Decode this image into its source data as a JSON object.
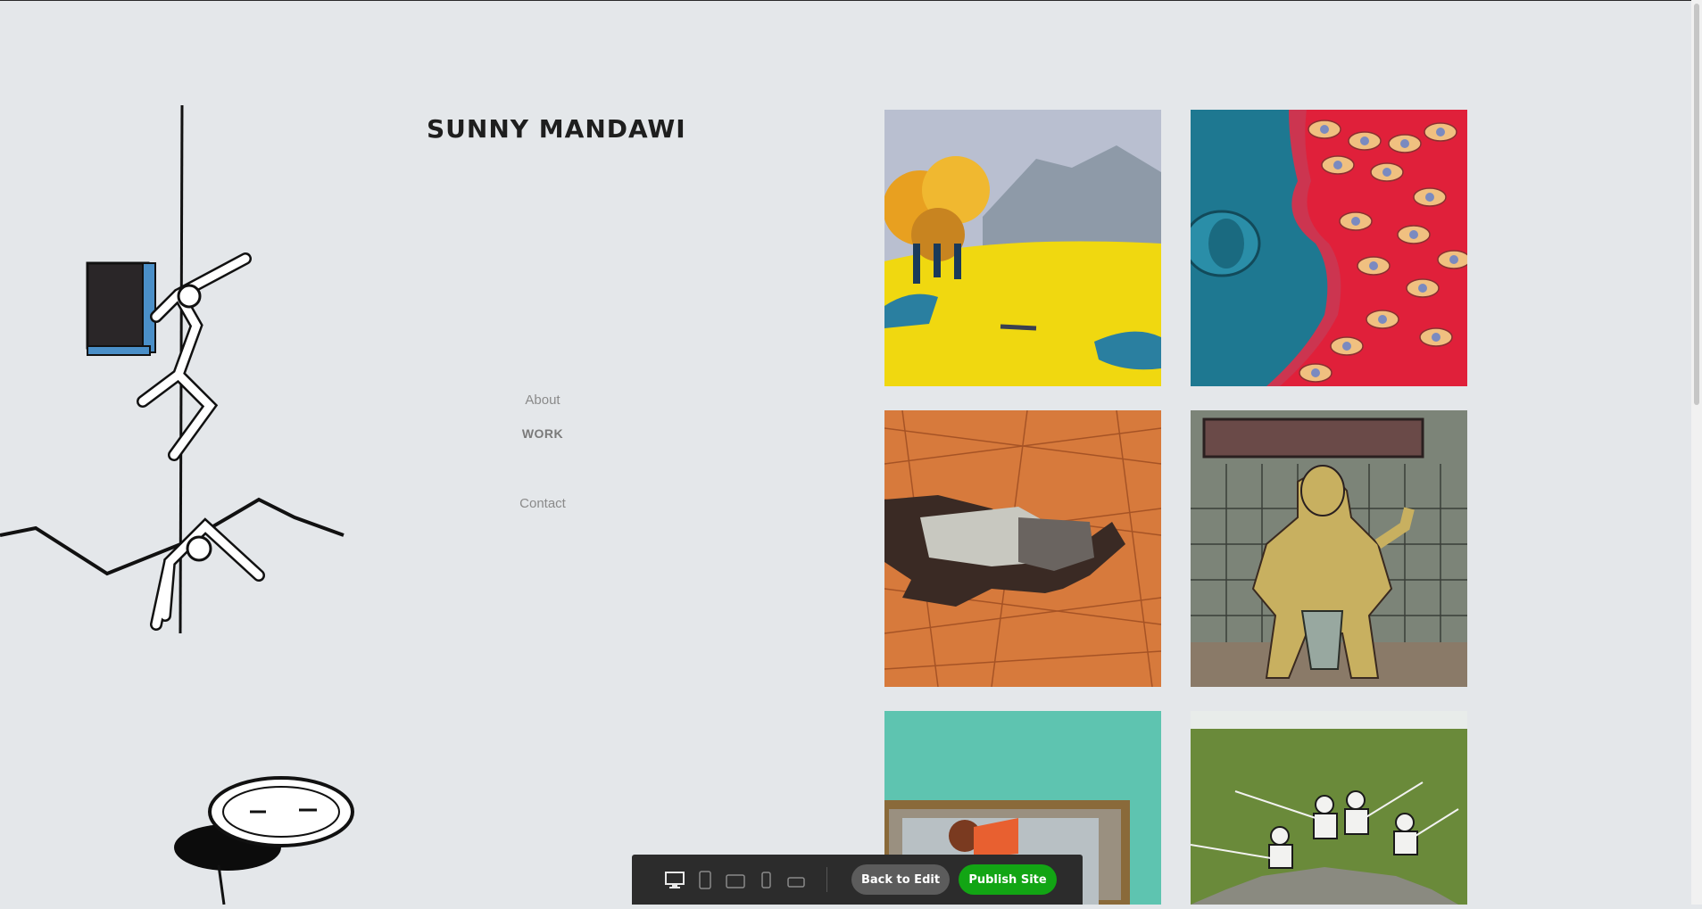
{
  "site": {
    "title": "SUNNY MANDAWI"
  },
  "nav": {
    "about": "About",
    "work": "WORK",
    "contact": "Contact"
  },
  "gallery": {
    "tiles": [
      {
        "name": "landscape-yellow-field"
      },
      {
        "name": "eyes-red-blue"
      },
      {
        "name": "figure-on-straw"
      },
      {
        "name": "man-shower-toilet"
      },
      {
        "name": "figure-in-window-teal"
      },
      {
        "name": "boys-fishing-green"
      }
    ]
  },
  "toolbar": {
    "devices": [
      "desktop-icon",
      "tablet-portrait-icon",
      "tablet-landscape-icon",
      "phone-portrait-icon",
      "phone-landscape-icon"
    ],
    "back_label": "Back to Edit",
    "publish_label": "Publish Site",
    "colors": {
      "bar": "#2c2c2c",
      "back": "#5c5c5c",
      "publish": "#12a514"
    }
  }
}
